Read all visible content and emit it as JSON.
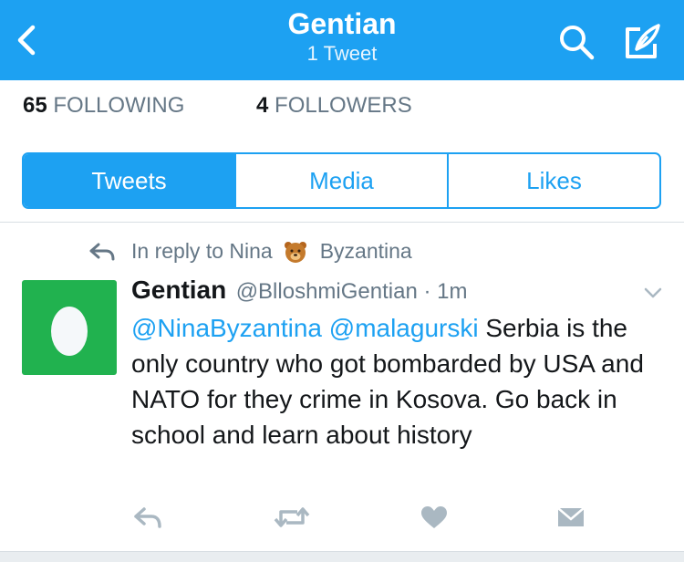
{
  "header": {
    "title": "Gentian",
    "subtitle": "1 Tweet",
    "background": "#1da1f2"
  },
  "stats": {
    "following_count": "65",
    "following_label": "FOLLOWING",
    "followers_count": "4",
    "followers_label": "FOLLOWERS"
  },
  "tabs": [
    {
      "label": "Tweets",
      "active": true
    },
    {
      "label": "Media",
      "active": false
    },
    {
      "label": "Likes",
      "active": false
    }
  ],
  "tweet": {
    "reply_prefix": "In reply to Nina",
    "reply_suffix": "Byzantina",
    "reply_emoji": "bear-face-icon",
    "author_name": "Gentian",
    "author_handle": "@BlloshmiGentian · 1m",
    "mention1": "@NinaByzantina",
    "mention2": "@malagurski",
    "body": "Serbia is the only country who got bombarded by USA and NATO for they crime in Kosova. Go back in school and learn about history",
    "avatar_color": "#21b24f",
    "mention_color": "#1da1f2"
  },
  "icons": {
    "back": "chevron-left-icon",
    "search": "search-icon",
    "compose": "compose-icon",
    "reply": "reply-icon",
    "retweet": "retweet-icon",
    "like": "heart-icon",
    "dm": "envelope-icon",
    "more": "chevron-down-icon"
  }
}
